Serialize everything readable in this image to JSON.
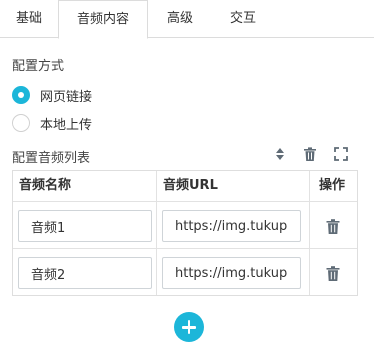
{
  "tabs": [
    {
      "label": "基础",
      "active": false
    },
    {
      "label": "音频内容",
      "active": true
    },
    {
      "label": "高级",
      "active": false
    },
    {
      "label": "交互",
      "active": false
    }
  ],
  "config_mode": {
    "label": "配置方式",
    "options": [
      {
        "label": "网页链接",
        "checked": true
      },
      {
        "label": "本地上传",
        "checked": false
      }
    ]
  },
  "audio_list": {
    "label": "配置音频列表",
    "toolbar_icons": [
      "sort-icon",
      "trash-icon",
      "fullscreen-icon"
    ],
    "columns": [
      "音频名称",
      "音频URL",
      "操作"
    ],
    "rows": [
      {
        "name": "音频1",
        "url": "https://img.tukuppt.com"
      },
      {
        "name": "音频2",
        "url": "https://img.tukuppt.com"
      }
    ]
  },
  "add_button_icon": "plus-icon",
  "colors": {
    "accent": "#1cb6d9",
    "icon": "#5f6b76",
    "border": "#dedede"
  }
}
